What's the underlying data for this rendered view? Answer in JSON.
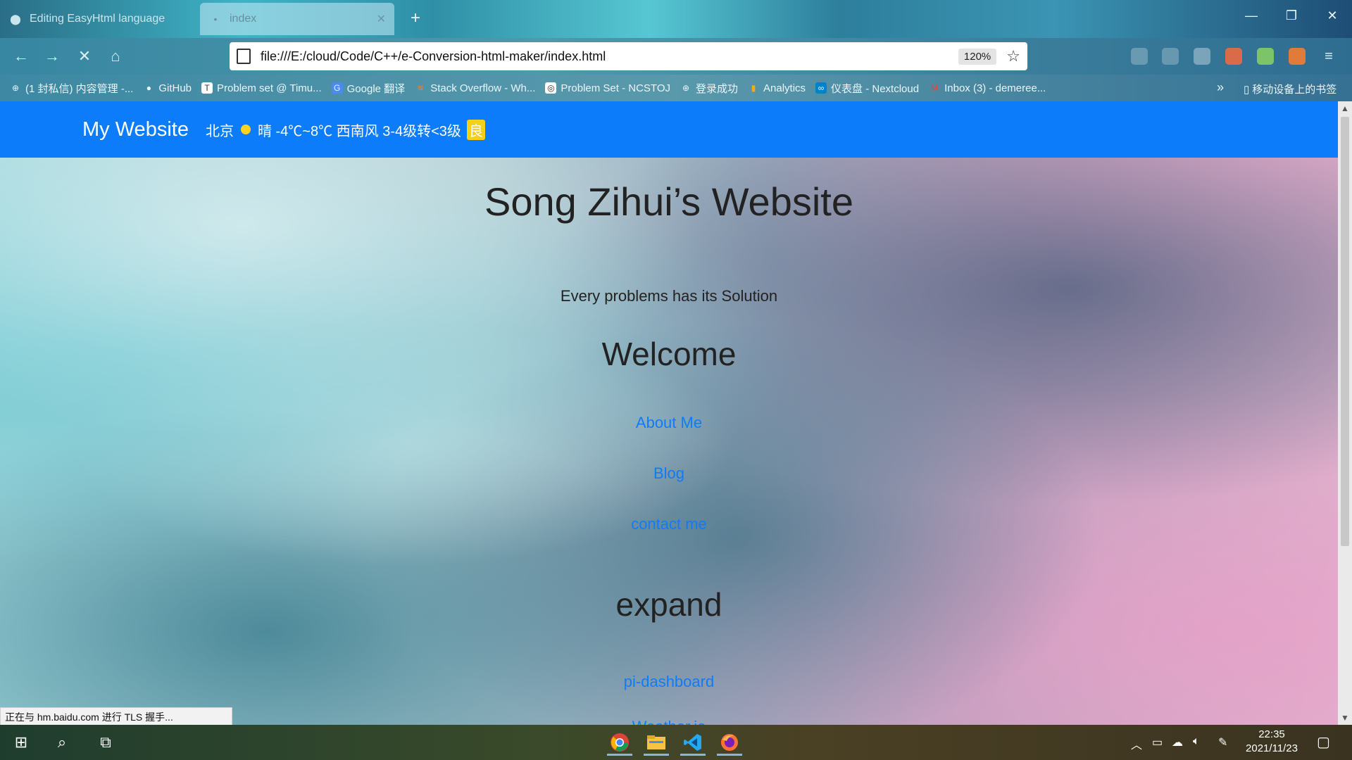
{
  "browser": {
    "tabs": [
      {
        "title": "Editing EasyHtml language",
        "active": false,
        "icon": "github-icon"
      },
      {
        "title": "index",
        "active": true,
        "icon": "loading-dot-icon"
      }
    ],
    "new_tab_label": "+",
    "window_controls": {
      "minimize": "—",
      "restore": "❐",
      "close": "✕"
    },
    "nav": {
      "back": "←",
      "forward": "→",
      "stop": "✕",
      "home": "⌂"
    },
    "url": "file:///E:/cloud/Code/C++/e-Conversion-html-maker/index.html",
    "zoom": "120%",
    "bookmarks": [
      {
        "label": "(1 封私信) 内容管理 -...",
        "icon": "globe-icon"
      },
      {
        "label": "GitHub",
        "icon": "github-icon"
      },
      {
        "label": "Problem set @ Timu...",
        "icon": "timu-icon"
      },
      {
        "label": "Google 翻译",
        "icon": "google-translate-icon"
      },
      {
        "label": "Stack Overflow - Wh...",
        "icon": "stackoverflow-icon"
      },
      {
        "label": "Problem Set - NCSTOJ",
        "icon": "ncstoj-icon"
      },
      {
        "label": "登录成功",
        "icon": "globe-icon"
      },
      {
        "label": "Analytics",
        "icon": "analytics-icon"
      },
      {
        "label": "仪表盘 - Nextcloud",
        "icon": "nextcloud-icon"
      },
      {
        "label": "Inbox (3) - demeree...",
        "icon": "gmail-icon"
      }
    ],
    "bookmarks_overflow": "»",
    "mobile_bookmarks": "移动设备上的书签",
    "status_text": "正在与 hm.baidu.com 进行 TLS 握手..."
  },
  "site": {
    "brand": "My Website",
    "weather": {
      "city": "北京",
      "text": "晴 -4℃~8℃ 西南风 3-4级转<3级",
      "aqi": "良"
    },
    "title": "Song Zihui’s Website",
    "motto": "Every problems has its Solution",
    "welcome_heading": "Welcome",
    "links": [
      "About Me",
      "Blog",
      "contact me"
    ],
    "expand_heading": "expand",
    "expand_links": [
      "pi-dashboard",
      "Weather.io"
    ]
  },
  "taskbar": {
    "apps": [
      "chrome-icon",
      "file-explorer-icon",
      "vscode-icon",
      "firefox-icon"
    ],
    "time": "22:35",
    "date": "2021/11/23"
  }
}
